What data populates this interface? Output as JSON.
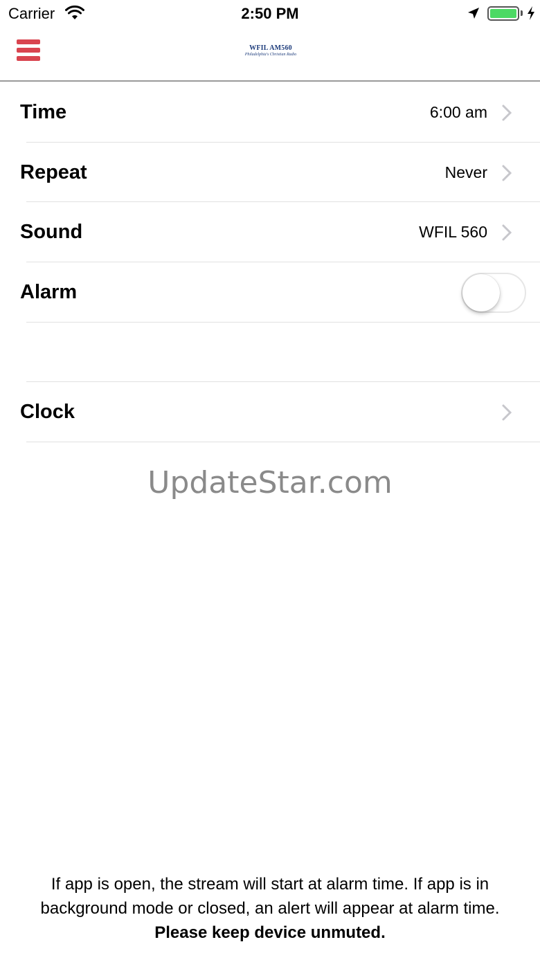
{
  "status_bar": {
    "carrier": "Carrier",
    "time": "2:50 PM",
    "icons": [
      "wifi-icon",
      "location-arrow-icon",
      "battery-icon",
      "charging-bolt-icon"
    ]
  },
  "nav": {
    "menu_icon": "hamburger-menu-icon",
    "logo_top": "WFIL AM560",
    "logo_bottom": "Philadelphia's Christian Radio",
    "accent_color": "#d9444f"
  },
  "settings": {
    "time": {
      "label": "Time",
      "value": "6:00 am"
    },
    "repeat": {
      "label": "Repeat",
      "value": "Never"
    },
    "sound": {
      "label": "Sound",
      "value": "WFIL 560"
    },
    "alarm": {
      "label": "Alarm",
      "enabled": false
    },
    "clock": {
      "label": "Clock"
    }
  },
  "watermark": "UpdateStar.com",
  "footer": {
    "line1": "If app is open, the stream will start at alarm time. If app is in",
    "line2": "background mode or closed, an alert will appear at alarm time.",
    "line3": "Please keep device unmuted."
  }
}
